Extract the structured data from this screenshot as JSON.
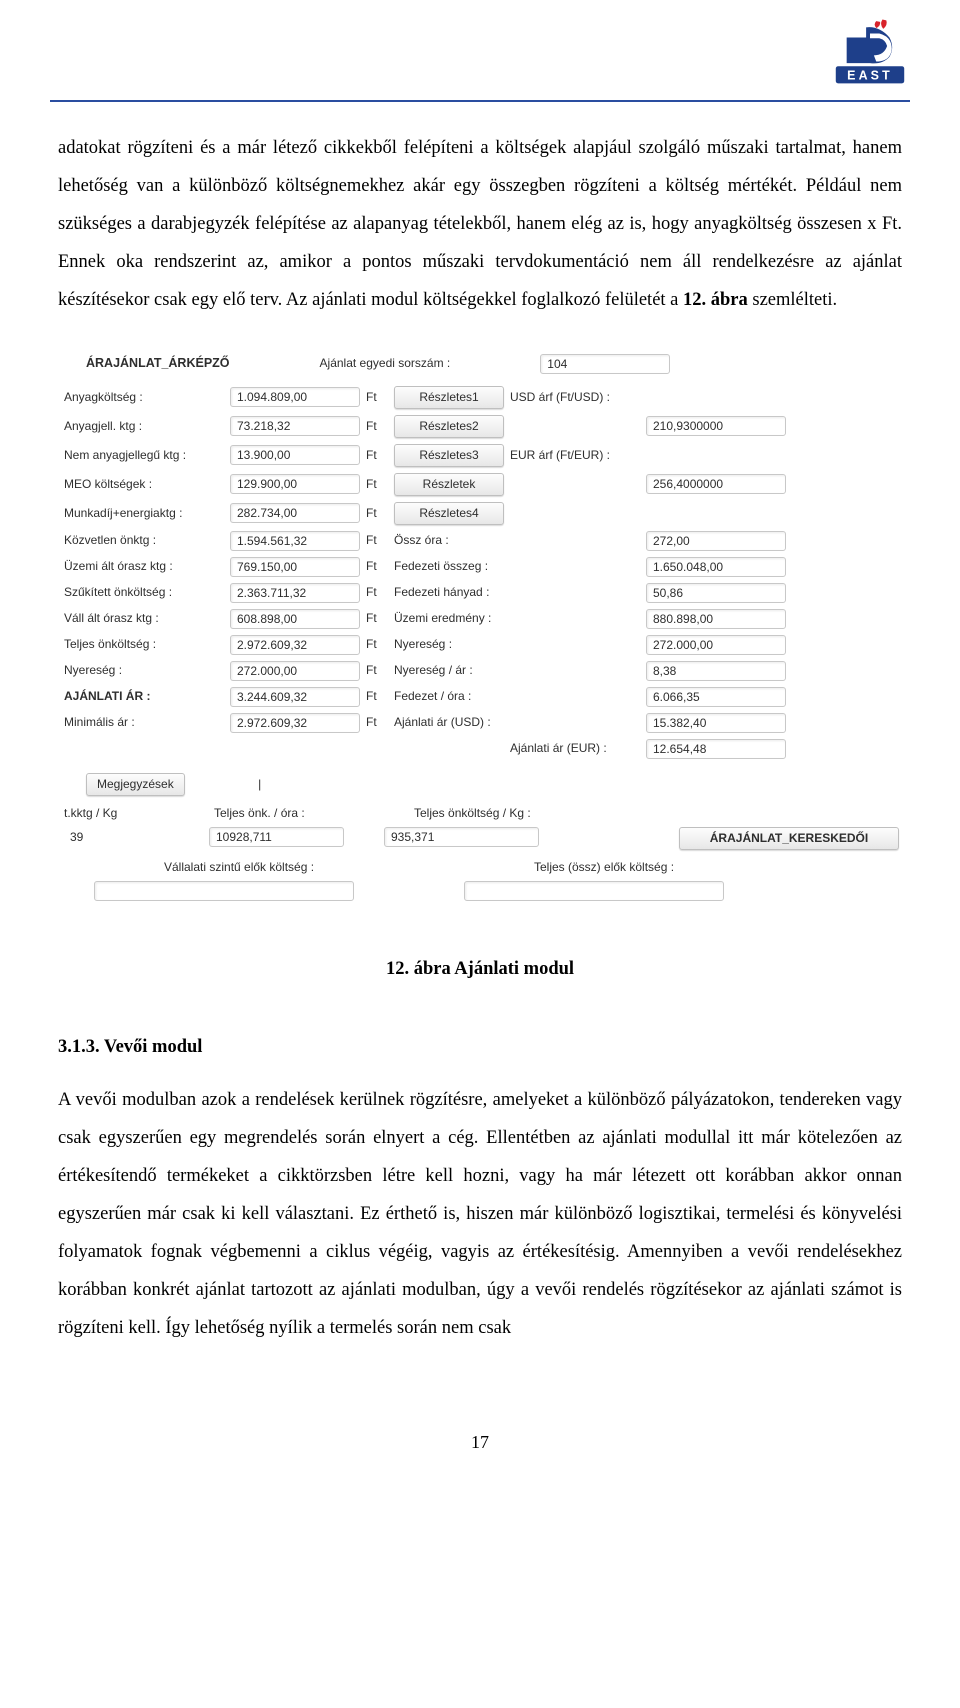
{
  "para1": "adatokat rögzíteni és a már létező cikkekből felépíteni a költségek alapjául szolgáló műszaki tartalmat, hanem lehetőség van a különböző költségnemekhez akár egy összegben rögzíteni a költség mértékét. Például nem szükséges a darabjegyzék felépítése az alapanyag tételekből, hanem elég az is, hogy anyagköltség összesen x Ft. Ennek oka rendszerint az, amikor a pontos műszaki tervdokumentáció nem áll rendelkezésre az ajánlat készítésekor csak egy elő terv. Az ajánlati modul költségekkel foglalkozó felületét a ",
  "para1_bold": "12. ábra",
  "para1_tail": " szemlélteti.",
  "app": {
    "header_title": "ÁRAJÁNLAT_ÁRKÉPZŐ",
    "header_midlabel": "Ajánlat egyedi sorszám :",
    "header_value": "104",
    "ft": "Ft",
    "rows": [
      {
        "l": "Anyagköltség :",
        "v": "1.094.809,00",
        "btn": "Részletes1",
        "rl": "USD árf (Ft/USD) :",
        "rv": ""
      },
      {
        "l": "Anyagjell. ktg :",
        "v": "73.218,32",
        "btn": "Részletes2",
        "rl": "",
        "rv": "210,9300000"
      },
      {
        "l": "Nem anyagjellegű ktg :",
        "v": "13.900,00",
        "btn": "Részletes3",
        "rl": "EUR árf (Ft/EUR) :",
        "rv": ""
      },
      {
        "l": "MEO költségek :",
        "v": "129.900,00",
        "btn": "Részletek",
        "rl": "",
        "rv": "256,4000000"
      },
      {
        "l": "Munkadíj+energiaktg :",
        "v": "282.734,00",
        "btn": "Részletes4",
        "rl": "",
        "rv": ""
      },
      {
        "l": "Közvetlen önktg :",
        "v": "1.594.561,32",
        "btn": "",
        "rl": "Össz óra :",
        "rv": "272,00"
      },
      {
        "l": "Üzemi ált órasz ktg :",
        "v": "769.150,00",
        "btn": "",
        "rl": "Fedezeti összeg :",
        "rv": "1.650.048,00"
      },
      {
        "l": "Szűkített önköltség :",
        "v": "2.363.711,32",
        "btn": "",
        "rl": "Fedezeti hányad :",
        "rv": "50,86"
      },
      {
        "l": "Váll ált órasz ktg :",
        "v": "608.898,00",
        "btn": "",
        "rl": "Üzemi eredmény :",
        "rv": "880.898,00"
      },
      {
        "l": "Teljes önköltség :",
        "v": "2.972.609,32",
        "btn": "",
        "rl": "Nyereség :",
        "rv": "272.000,00"
      },
      {
        "l": "Nyereség :",
        "v": "272.000,00",
        "btn": "",
        "rl": "Nyereség / ár :",
        "rv": "8,38"
      },
      {
        "l": "AJÁNLATI ÁR :",
        "v": "3.244.609,32",
        "btn": "",
        "rl": "Fedezet / óra :",
        "rv": "6.066,35"
      },
      {
        "l": "Minimális ár :",
        "v": "2.972.609,32",
        "btn": "",
        "rl": "Ajánlati ár (USD) :",
        "rv": "15.382,40"
      }
    ],
    "last_rl": "Ajánlati ár (EUR) :",
    "last_rv": "12.654,48",
    "notes_btn": "Megjegyzések",
    "bottom_head": [
      "t.kktg / Kg",
      "Teljes önk. / óra :",
      "Teljes önköltség / Kg :",
      ""
    ],
    "bottom_row": [
      "39",
      "10928,711",
      "935,371"
    ],
    "trade_btn": "ÁRAJÁNLAT_KERESKEDŐI",
    "bottom2_l": "Vállalati szintű elők költség :",
    "bottom2_r": "Teljes (össz) elők költség :"
  },
  "fig_caption": "12. ábra Ajánlati modul",
  "h3": "3.1.3. Vevői modul",
  "para2": "A vevői modulban azok a rendelések kerülnek rögzítésre, amelyeket a különböző pályázatokon, tendereken vagy csak egyszerűen egy megrendelés során elnyert a cég. Ellentétben az ajánlati modullal itt már kötelezően az értékesítendő termékeket a cikktörzsben létre kell hozni, vagy ha már létezett ott korábban akkor onnan egyszerűen már csak ki kell választani. Ez érthető is, hiszen már különböző logisztikai, termelési és könyvelési folyamatok fognak végbemenni a ciklus végéig, vagyis az értékesítésig. Amennyiben a vevői rendelésekhez korábban konkrét ajánlat tartozott az ajánlati modulban, úgy a vevői rendelés rögzítésekor az ajánlati számot is rögzíteni kell. Így lehetőség nyílik a termelés során nem csak",
  "pagenum": "17"
}
